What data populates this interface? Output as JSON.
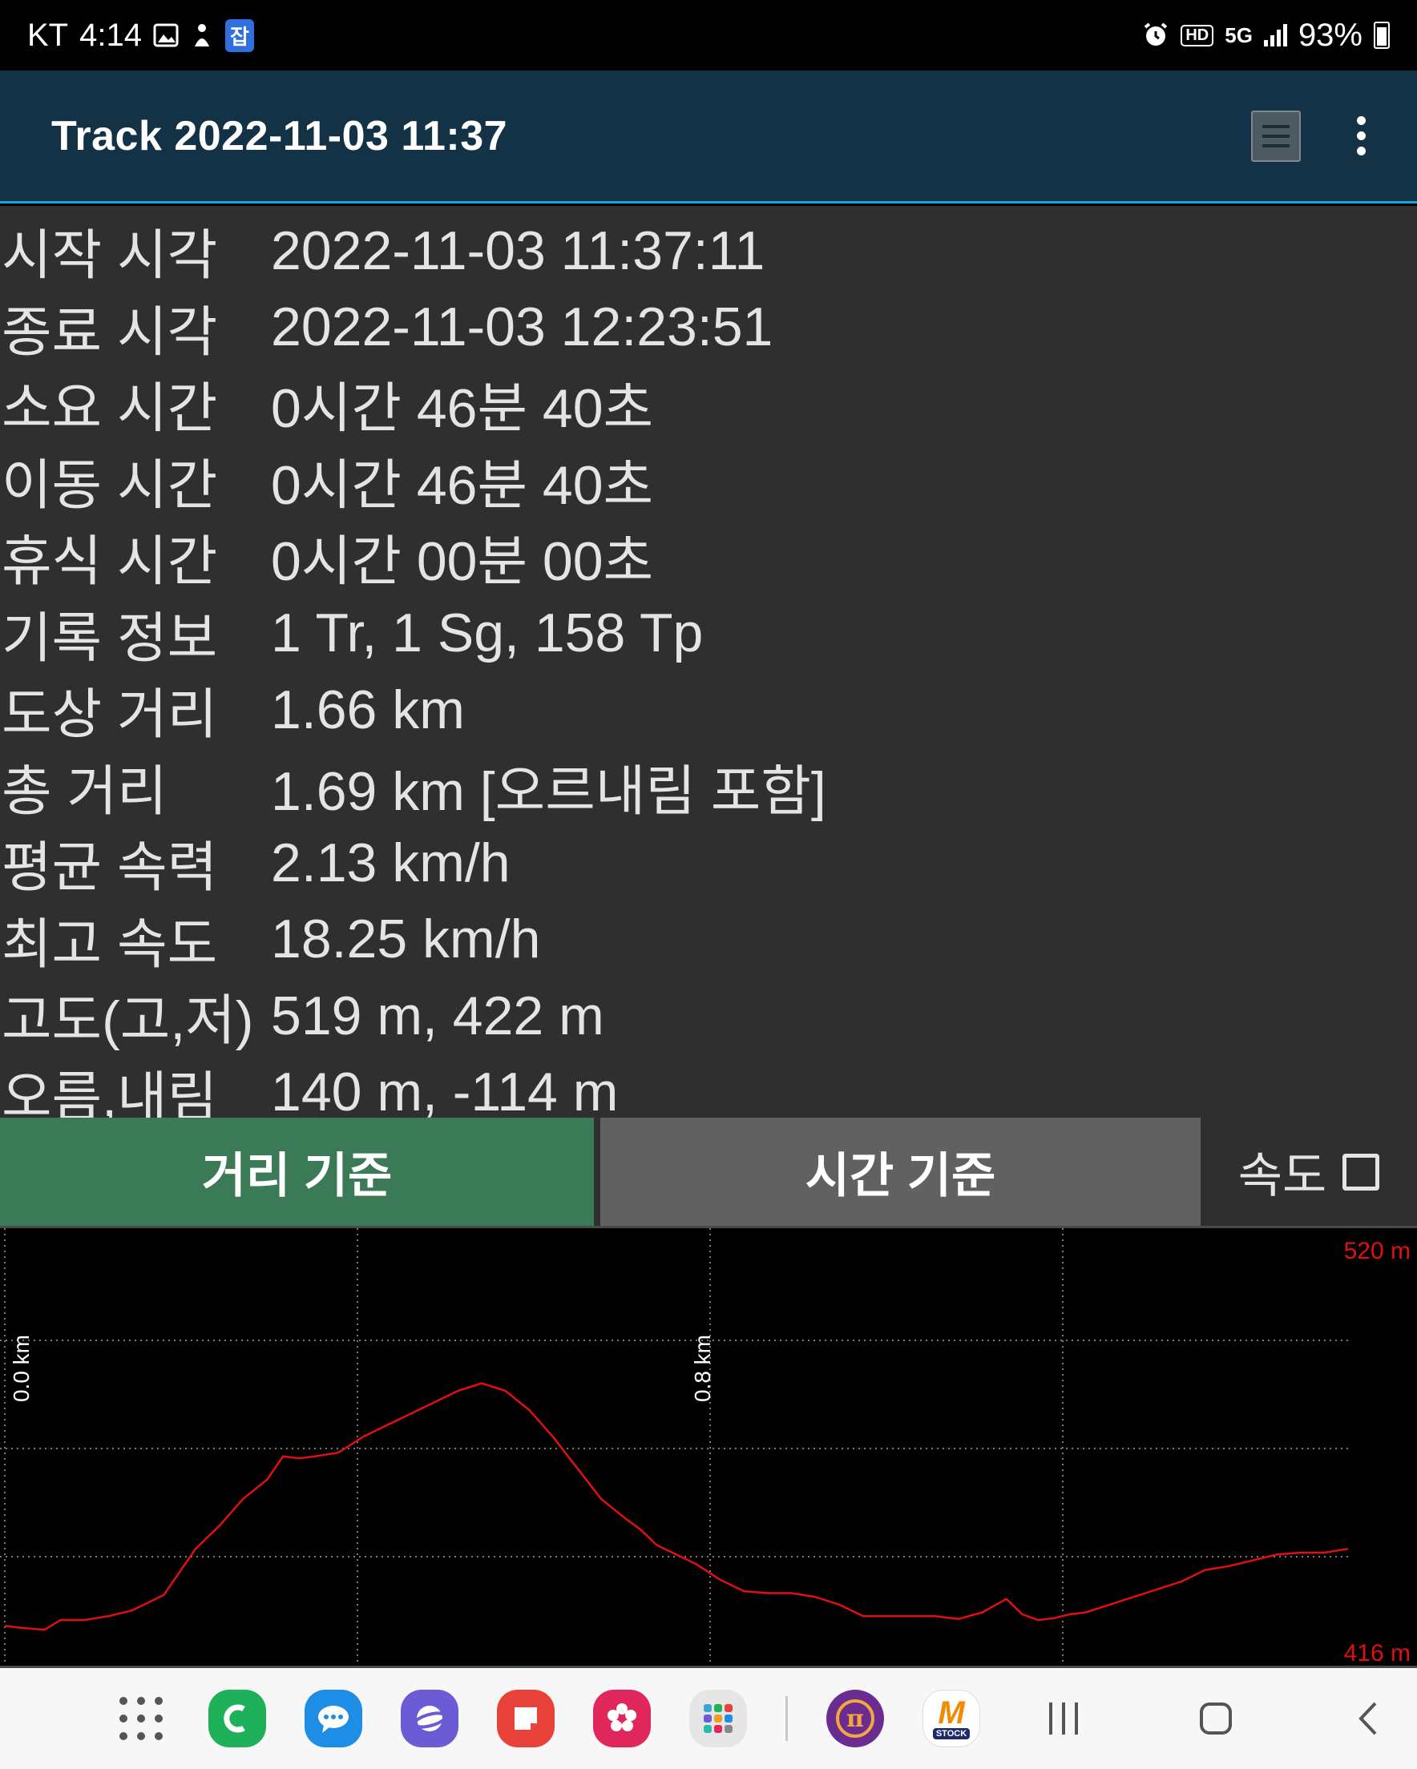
{
  "status_bar": {
    "carrier": "KT",
    "time": "4:14",
    "battery": "93%",
    "icons_left": [
      "image-icon",
      "notification-figure-icon",
      "app-badge-icon"
    ],
    "app_badge": "잡",
    "icons_right": [
      "alarm-icon",
      "hd-voice-icon",
      "5g-icon",
      "signal-icon",
      "battery-icon"
    ],
    "hd_label": "HD",
    "network_label": "5G"
  },
  "app_bar": {
    "title": "Track 2022-11-03 11:37"
  },
  "info": [
    {
      "label": "시작 시각",
      "value": "2022-11-03 11:37:11"
    },
    {
      "label": "종료 시각",
      "value": "2022-11-03 12:23:51"
    },
    {
      "label": "소요 시간",
      "value": "0시간 46분 40초"
    },
    {
      "label": "이동 시간",
      "value": "0시간 46분 40초"
    },
    {
      "label": "휴식 시간",
      "value": "0시간 00분 00초"
    },
    {
      "label": "기록 정보",
      "value": "1 Tr, 1 Sg, 158 Tp"
    },
    {
      "label": "도상 거리",
      "value": "1.66 km"
    },
    {
      "label": "총 거리",
      "value": "1.69 km [오르내림 포함]"
    },
    {
      "label": "평균 속력",
      "value": "2.13 km/h"
    },
    {
      "label": "최고 속도",
      "value": "18.25 km/h"
    },
    {
      "label": "고도(고,저)",
      "value": "519 m, 422 m"
    },
    {
      "label": "오름,내림",
      "value": "140 m, -114 m"
    }
  ],
  "toggles": {
    "distance_label": "거리 기준",
    "time_label": "시간 기준",
    "speed_label": "속도",
    "speed_checked": false,
    "selected": "distance"
  },
  "chart_data": {
    "type": "line",
    "x_unit": "km",
    "x_tick_labels": [
      "0.0 km",
      "0.8 km"
    ],
    "y_top_label": "520 m",
    "y_bottom_label": "416 m",
    "ylim": [
      416,
      520
    ],
    "xlim": [
      0,
      1.69
    ],
    "grid": true,
    "line_color": "#e01010",
    "label_color": "#e01010",
    "series": [
      {
        "x": [
          0.0,
          0.02,
          0.05,
          0.07,
          0.1,
          0.13,
          0.16,
          0.2,
          0.22,
          0.24,
          0.27,
          0.3,
          0.33,
          0.35,
          0.37,
          0.39,
          0.42,
          0.45,
          0.48,
          0.51,
          0.54,
          0.57,
          0.6,
          0.63,
          0.66,
          0.69,
          0.72,
          0.75,
          0.78,
          0.8,
          0.82,
          0.85,
          0.87,
          0.9,
          0.93,
          0.96,
          0.99,
          1.02,
          1.05,
          1.08,
          1.11,
          1.14,
          1.17,
          1.2,
          1.23,
          1.26,
          1.28,
          1.3,
          1.32,
          1.34,
          1.36,
          1.39,
          1.42,
          1.45,
          1.48,
          1.51,
          1.54,
          1.57,
          1.6,
          1.63,
          1.66,
          1.69
        ],
        "y": [
          423,
          422.5,
          422,
          424.5,
          424.5,
          425.5,
          427,
          431,
          437,
          443,
          449,
          456,
          461,
          467,
          466.5,
          467,
          468,
          472,
          475,
          478,
          481,
          484,
          486,
          484,
          479,
          472,
          464,
          456,
          451,
          448,
          444,
          441,
          439,
          435,
          432,
          431.5,
          431.5,
          430.5,
          428.5,
          425.5,
          425.5,
          425.5,
          425.5,
          424.8,
          426.5,
          430,
          426,
          424.5,
          425,
          426,
          426.5,
          428.5,
          430.5,
          432.5,
          434.5,
          437.5,
          438.5,
          440,
          441.5,
          442,
          442,
          443
        ]
      }
    ]
  },
  "nav_bar": {
    "apps": [
      {
        "name": "app-drawer-icon"
      },
      {
        "name": "phone-app-icon",
        "glyph": "C",
        "color": "#1fb05a"
      },
      {
        "name": "messages-app-icon",
        "glyph": "•••",
        "color": "#1e8de6"
      },
      {
        "name": "internet-app-icon",
        "glyph": "◐",
        "color": "#6b5cd6"
      },
      {
        "name": "notes-app-icon",
        "glyph": "▰",
        "color": "#e8413a"
      },
      {
        "name": "gallery-app-icon",
        "glyph": "✿",
        "color": "#e0265a"
      },
      {
        "name": "folder-app-icon",
        "glyph": "⁘",
        "color": "#e6e6e6"
      },
      {
        "name": "pi-network-app-icon",
        "glyph": "π",
        "color": "#6a2c91"
      },
      {
        "name": "mstock-app-icon",
        "glyph": "M",
        "color": "#ffffff"
      }
    ],
    "mstock_sub": "STOCK"
  }
}
